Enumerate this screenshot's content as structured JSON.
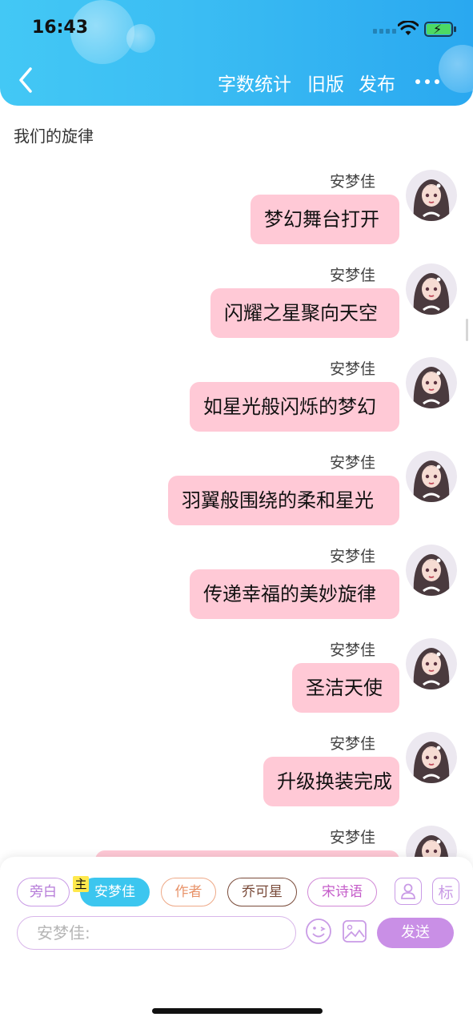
{
  "status_bar": {
    "time": "16:43"
  },
  "header": {
    "nav": [
      "字数统计",
      "旧版",
      "发布"
    ]
  },
  "title": "我们的旋律",
  "messages": [
    {
      "name": "安梦佳",
      "text": "梦幻舞台打开"
    },
    {
      "name": "安梦佳",
      "text": "闪耀之星聚向天空"
    },
    {
      "name": "安梦佳",
      "text": "如星光般闪烁的梦幻"
    },
    {
      "name": "安梦佳",
      "text": "羽翼般围绕的柔和星光"
    },
    {
      "name": "安梦佳",
      "text": "传递幸福的美妙旋律"
    },
    {
      "name": "安梦佳",
      "text": "圣洁天使"
    },
    {
      "name": "安梦佳",
      "text": "升级换装完成"
    },
    {
      "name": "安梦佳",
      "text": ""
    }
  ],
  "roles": [
    {
      "label": "旁白"
    },
    {
      "label": "安梦佳",
      "tag": "主"
    },
    {
      "label": "作者"
    },
    {
      "label": "乔可星"
    },
    {
      "label": "宋诗语"
    }
  ],
  "role_icons": {
    "tag_label": "标"
  },
  "input": {
    "placeholder": "安梦佳:"
  },
  "send_label": "发送",
  "colors": {
    "header": "#3bbdf3",
    "bubble": "#ffc9d6",
    "selected_role": "#3cc6ef",
    "send": "#c98fe6"
  },
  "icons": [
    "back-arrow-icon",
    "more-icon",
    "person-icon",
    "emoji-icon",
    "image-icon"
  ]
}
